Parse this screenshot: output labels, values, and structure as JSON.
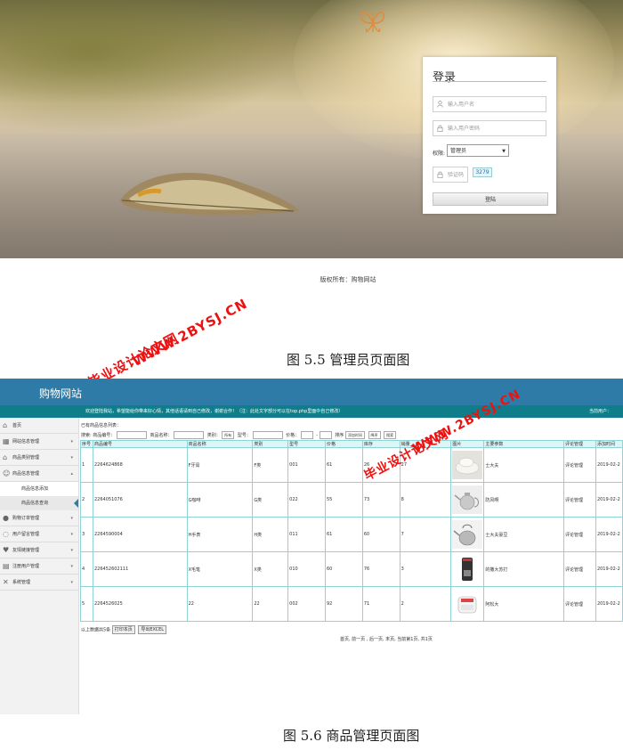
{
  "login_page": {
    "title": "登录",
    "username_placeholder": "输入用户名",
    "password_placeholder": "输入用户密码",
    "role_label": "权限:",
    "role_value": "管理员",
    "captcha_placeholder": "验证码",
    "captcha_code": "3279",
    "login_button": "登陆",
    "copyright": "版权所有：购物网站"
  },
  "caption1": "图 5.5  管理员页面图",
  "caption2": "图 5.6  商品管理页面图",
  "watermark": {
    "url": "WWW.2BYSJ.CN",
    "text": "毕业设计论文网"
  },
  "admin": {
    "site_title": "购物网站",
    "welcome": "欢迎登陆我站，希望能给你带来好心情，其他话语请到自己修改，谢谢合作！（注：此处文字部分可以在top.php里面中自己修改）",
    "current_user": "当前用户：",
    "sidebar": [
      {
        "label": "首页",
        "icon": "home-icon",
        "chevron": ""
      },
      {
        "label": "网站信息管理",
        "icon": "grid-icon",
        "chevron": "▾"
      },
      {
        "label": "商品类别管理",
        "icon": "house-icon",
        "chevron": "▾"
      },
      {
        "label": "商品信息管理",
        "icon": "users-icon",
        "chevron": "▴"
      }
    ],
    "sub_items": [
      "商品信息添加",
      "商品信息查询"
    ],
    "sidebar_rest": [
      {
        "label": "购物订单管理",
        "icon": "user-icon",
        "chevron": "▾"
      },
      {
        "label": "用户留言管理",
        "icon": "chat-icon",
        "chevron": "▾"
      },
      {
        "label": "友情链接管理",
        "icon": "heart-icon",
        "chevron": "▾"
      },
      {
        "label": "注册用户管理",
        "icon": "table-icon",
        "chevron": "▾"
      },
      {
        "label": "系统管理",
        "icon": "tools-icon",
        "chevron": "▾"
      }
    ],
    "list_title": "已有商品信息列表：",
    "filters": {
      "search": "搜索:",
      "code": "商品编号：",
      "name": "商品名称：",
      "category": "类别：",
      "category_val": "所有",
      "model": "型号：",
      "price": "价格：",
      "price_sep": "-",
      "sort": "排序",
      "sort_val": "添加时间",
      "order_val": "降序",
      "go": "搜索"
    },
    "columns": [
      "序号",
      "商品编号",
      "商品名称",
      "类别",
      "型号",
      "价格",
      "库存",
      "销量",
      "图片",
      "主要参数",
      "评论管理",
      "添加时间"
    ],
    "rows": [
      {
        "no": "1",
        "code": "2264624868",
        "name": "F牙膏",
        "cat": "F类",
        "model": "001",
        "price": "61",
        "stock": "26",
        "sales": "27",
        "img": "plate",
        "param": "士大夫",
        "review": "评论管理",
        "date": "2019-02-2"
      },
      {
        "no": "2",
        "code": "2264051076",
        "name": "G咖啡",
        "cat": "G类",
        "model": "022",
        "price": "55",
        "stock": "73",
        "sales": "8",
        "img": "teapot",
        "param": "防风啊",
        "review": "评论管理",
        "date": "2019-02-2"
      },
      {
        "no": "3",
        "code": "2264590004",
        "name": "H手表",
        "cat": "H类",
        "model": "011",
        "price": "61",
        "stock": "60",
        "sales": "7",
        "img": "kettle",
        "param": "士大夫豪豆",
        "review": "评论管理",
        "date": "2019-02-2"
      },
      {
        "no": "4",
        "code": "2264526021​11",
        "name": "X毛笔",
        "cat": "X类",
        "model": "010",
        "price": "60",
        "stock": "76",
        "sales": "3",
        "img": "coffee-machine",
        "param": "的撒大苏打",
        "review": "评论管理",
        "date": "2019-02-2"
      },
      {
        "no": "5",
        "code": "2264526025",
        "name": "22",
        "cat": "22",
        "model": "002",
        "price": "92",
        "stock": "71",
        "sales": "2",
        "img": "bread-maker",
        "param": "阿松大",
        "review": "评论管理",
        "date": "2019-02-2"
      }
    ],
    "operations_label": "以上数据共5条",
    "print_button": "打印本页",
    "export_button": "导出EXCEL",
    "pagination": "首页, 前一页 , 后一页, 末页, 当前第1页, 共1页"
  }
}
